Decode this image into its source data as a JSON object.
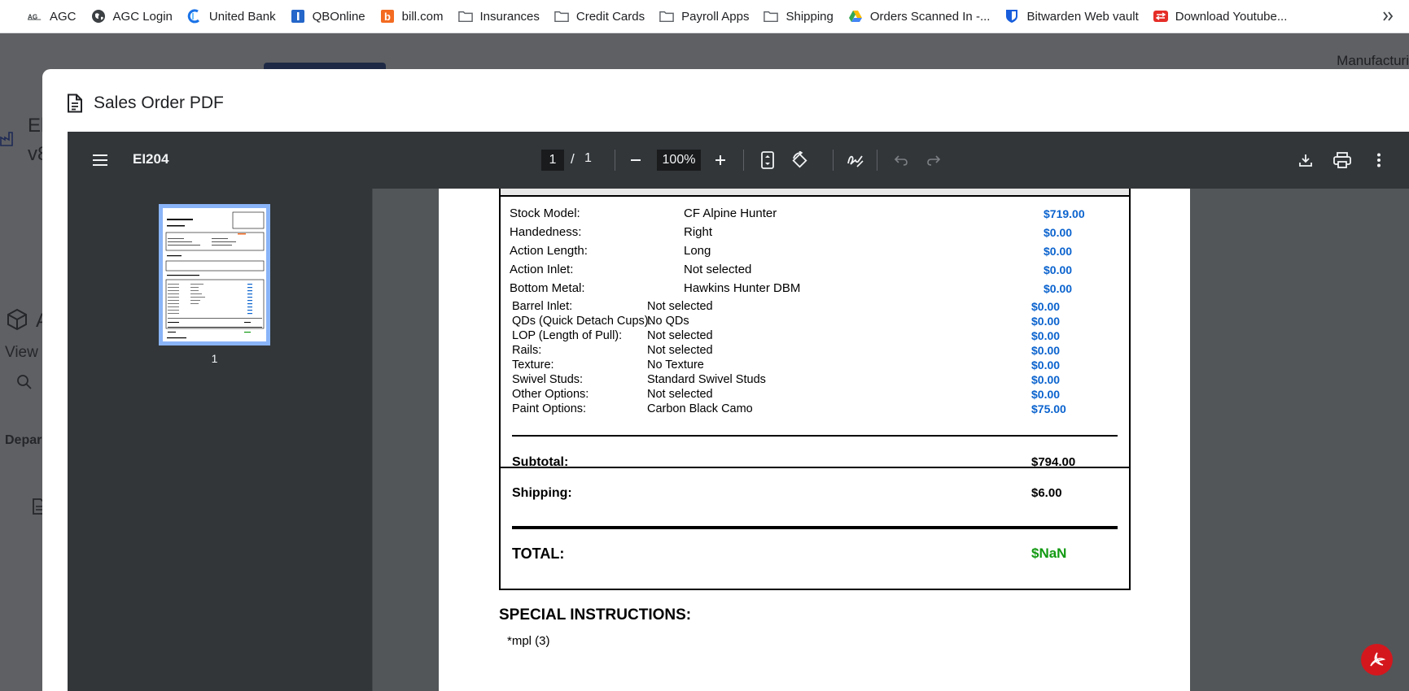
{
  "bookmarks": [
    {
      "label": "AGC",
      "icon": "agc-logo-icon"
    },
    {
      "label": "AGC Login",
      "icon": "globe-icon"
    },
    {
      "label": "United Bank",
      "icon": "united-bank-icon"
    },
    {
      "label": "QBOnline",
      "icon": "qbonline-icon"
    },
    {
      "label": "bill.com",
      "icon": "bill-com-icon"
    },
    {
      "label": "Insurances",
      "icon": "folder-icon"
    },
    {
      "label": "Credit Cards",
      "icon": "folder-icon"
    },
    {
      "label": "Payroll Apps",
      "icon": "folder-icon"
    },
    {
      "label": "Shipping",
      "icon": "folder-icon"
    },
    {
      "label": "Orders Scanned In -...",
      "icon": "google-drive-icon"
    },
    {
      "label": "Bitwarden Web vault",
      "icon": "bitwarden-icon"
    },
    {
      "label": "Download Youtube...",
      "icon": "youtube-downloader-icon"
    }
  ],
  "background": {
    "top_right_text": "Manufacturi",
    "fragments": [
      "El",
      "v8",
      "A",
      "View",
      "Depar"
    ]
  },
  "modal": {
    "title": "Sales Order PDF"
  },
  "viewer": {
    "doc_title": "EI204",
    "page_current": "1",
    "page_separator": "/",
    "page_total": "1",
    "zoom": "100%",
    "thumbnail_label": "1"
  },
  "order": {
    "main_items": [
      {
        "label": "Stock Model:",
        "value": "CF Alpine Hunter",
        "price": "$719.00"
      },
      {
        "label": "Handedness:",
        "value": "Right",
        "price": "$0.00"
      },
      {
        "label": "Action Length:",
        "value": "Long",
        "price": "$0.00"
      },
      {
        "label": "Action Inlet:",
        "value": "Not selected",
        "price": "$0.00"
      },
      {
        "label": "Bottom Metal:",
        "value": "Hawkins Hunter DBM",
        "price": "$0.00"
      }
    ],
    "options": [
      {
        "label": "Barrel Inlet:",
        "value": "Not selected",
        "price": "$0.00"
      },
      {
        "label": "QDs (Quick Detach Cups):",
        "value": "No QDs",
        "price": "$0.00"
      },
      {
        "label": "LOP (Length of Pull):",
        "value": "Not selected",
        "price": "$0.00"
      },
      {
        "label": "Rails:",
        "value": "Not selected",
        "price": "$0.00"
      },
      {
        "label": "Texture:",
        "value": "No Texture",
        "price": "$0.00"
      },
      {
        "label": "Swivel Studs:",
        "value": "Standard Swivel Studs",
        "price": "$0.00"
      },
      {
        "label": "Other Options:",
        "value": "Not selected",
        "price": "$0.00"
      },
      {
        "label": "Paint Options:",
        "value": "Carbon Black Camo",
        "price": "$75.00"
      }
    ],
    "subtotal_label": "Subtotal:",
    "subtotal_value": "$794.00",
    "shipping_label": "Shipping:",
    "shipping_value": "$6.00",
    "total_label": "TOTAL:",
    "total_value": "$NaN",
    "special_title": "SPECIAL INSTRUCTIONS:",
    "special_note": "*mpl (3)"
  },
  "colors": {
    "price_blue": "#0b63ce",
    "total_green": "#129a12",
    "toolbar_bg": "#323639",
    "viewer_bg": "#525659",
    "thumb_highlight": "#8ab4f8",
    "acrobat_red": "#d4171d"
  }
}
